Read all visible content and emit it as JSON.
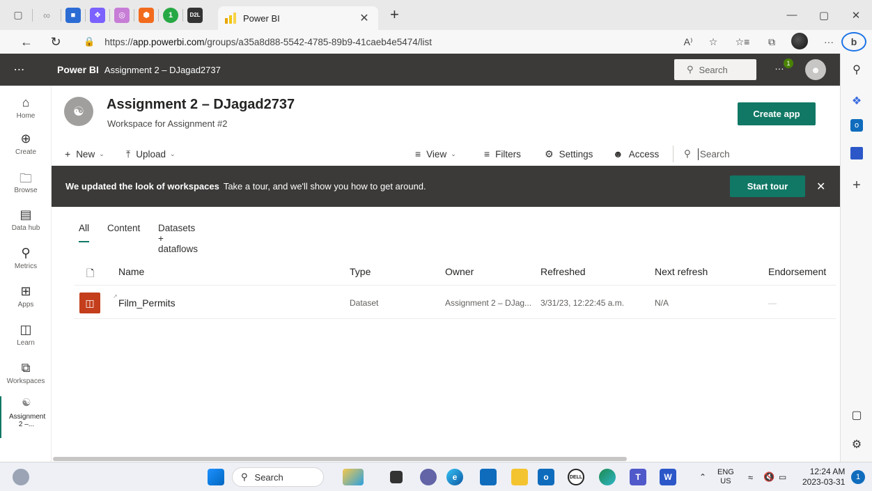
{
  "browser": {
    "tab_title": "Power BI",
    "url_prefix": "https://",
    "url_host": "app.powerbi.com",
    "url_path": "/groups/a35a8d88-5542-4785-89b9-41caeb4e5474/list",
    "pinned_d2l_label": "D2L",
    "reading_aloud_label": "A⁾",
    "more_label": "···",
    "bing_label": "b"
  },
  "header": {
    "brand": "Power BI",
    "breadcrumb": "Assignment 2 – DJagad2737",
    "search_placeholder": "Search",
    "notification_count": "1",
    "notification_dots": "…"
  },
  "leftnav": {
    "items": [
      {
        "label": "Home",
        "icon": "home-icon"
      },
      {
        "label": "Create",
        "icon": "plus-circle-icon"
      },
      {
        "label": "Browse",
        "icon": "folder-icon"
      },
      {
        "label": "Data hub",
        "icon": "data-hub-icon"
      },
      {
        "label": "Metrics",
        "icon": "trophy-icon"
      },
      {
        "label": "Apps",
        "icon": "apps-icon"
      },
      {
        "label": "Learn",
        "icon": "book-icon"
      },
      {
        "label": "Workspaces",
        "icon": "workspaces-icon"
      },
      {
        "label": "Assignment 2 –...",
        "icon": "workspace-group-icon"
      }
    ]
  },
  "workspace": {
    "title": "Assignment 2 – DJagad2737",
    "subtitle": "Workspace for Assignment #2",
    "create_app_label": "Create app"
  },
  "toolbar": {
    "new_label": "New",
    "upload_label": "Upload",
    "view_label": "View",
    "filters_label": "Filters",
    "settings_label": "Settings",
    "access_label": "Access",
    "search_placeholder": "Search"
  },
  "banner": {
    "headline": "We updated the look of workspaces",
    "text": "Take a tour, and we'll show you how to get around.",
    "button_label": "Start tour"
  },
  "content_tabs": [
    "All",
    "Content",
    "Datasets + dataflows"
  ],
  "table": {
    "columns": [
      "Name",
      "Type",
      "Owner",
      "Refreshed",
      "Next refresh",
      "Endorsement"
    ],
    "rows": [
      {
        "name": "Film_Permits",
        "type": "Dataset",
        "owner": "Assignment 2 – DJag...",
        "refreshed": "3/31/23, 12:22:45 a.m.",
        "next_refresh": "N/A",
        "endorsement": "—"
      }
    ]
  },
  "taskbar": {
    "search_label": "Search",
    "lang_top": "ENG",
    "lang_bottom": "US",
    "time": "12:24 AM",
    "date": "2023-03-31",
    "notification_count": "1"
  },
  "colors": {
    "accent": "#117865",
    "header_bg": "#3b3a39",
    "dataset_icon": "#c43e1c"
  }
}
